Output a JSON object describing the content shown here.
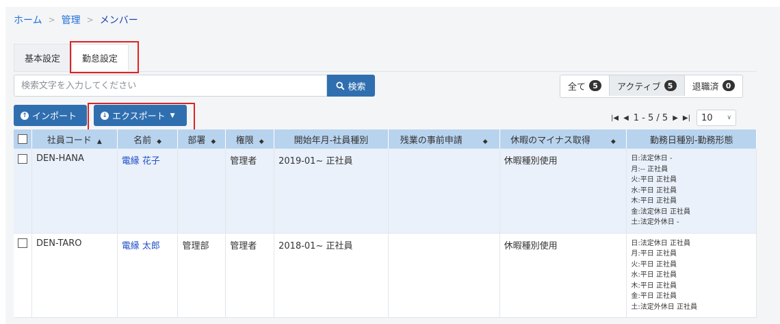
{
  "breadcrumb": {
    "home": "ホーム",
    "admin": "管理",
    "current": "メンバー",
    "separator": ">"
  },
  "tabs": [
    {
      "label": "基本設定"
    },
    {
      "label": "勤怠設定"
    }
  ],
  "search": {
    "placeholder": "検索文字を入力してください",
    "button_label": "検索"
  },
  "filters": [
    {
      "label": "全て",
      "count": "5"
    },
    {
      "label": "アクティブ",
      "count": "5"
    },
    {
      "label": "退職済",
      "count": "0"
    }
  ],
  "actions": {
    "import_label": "インポート",
    "export_label": "エクスポート"
  },
  "pager": {
    "range": "1 - 5 / 5",
    "page_size": "10"
  },
  "table": {
    "headers": [
      "社員コード",
      "名前",
      "部署",
      "権限",
      "開始年月-社員種別",
      "残業の事前申請",
      "休暇のマイナス取得",
      "勤務日種別-勤務形態"
    ],
    "rows": [
      {
        "code": "DEN-HANA",
        "name": "電縁 花子",
        "dept": "",
        "role": "管理者",
        "start": "2019-01~ 正社員",
        "overtime": "",
        "leave": "休暇種別使用",
        "schedule": [
          "日:法定休日 -",
          "月:-- 正社員",
          "火:平日 正社員",
          "水:平日 正社員",
          "木:平日 正社員",
          "金:法定休日 正社員",
          "土:法定外休日 -"
        ]
      },
      {
        "code": "DEN-TARO",
        "name": "電縁 太郎",
        "dept": "管理部",
        "role": "管理者",
        "start": "2018-01~ 正社員",
        "overtime": "",
        "leave": "休暇種別使用",
        "schedule": [
          "日:法定休日 正社員",
          "月:平日 正社員",
          "火:平日 正社員",
          "水:平日 正社員",
          "木:平日 正社員",
          "金:平日 正社員",
          "土:法定外休日 正社員"
        ]
      }
    ]
  },
  "colors": {
    "primary": "#2f6fb0",
    "header_bg": "#b8d3ee",
    "highlight": "#e02020",
    "link": "#1f4fc8"
  }
}
